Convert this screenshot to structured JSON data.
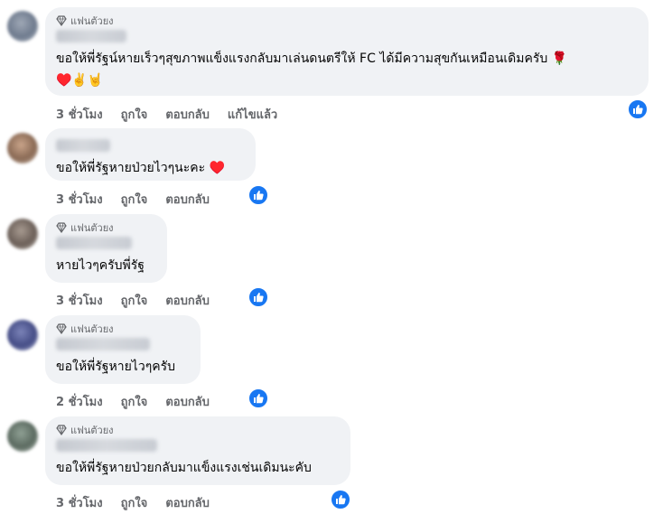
{
  "comments": [
    {
      "badge": "แฟนตัวยง",
      "text": "ขอให้พี่รัฐน์หายเร็วๆสุขภาพแข็งแรงกลับมาเล่นดนตรีให้ FC ได้มีความสุขกันเหมือนเดิมครับ 🌹",
      "text2": "♥️✌️🤘",
      "time": "3 ชั่วโมง",
      "like": "ถูกใจ",
      "reply": "ตอบกลับ",
      "edited": "แก้ไขแล้ว"
    },
    {
      "text": "ขอให้พี่รัฐหายป่วยไวๆนะคะ ♥️",
      "time": "3 ชั่วโมง",
      "like": "ถูกใจ",
      "reply": "ตอบกลับ"
    },
    {
      "badge": "แฟนตัวยง",
      "text": "หายไวๆครับพี่รัฐ",
      "time": "3 ชั่วโมง",
      "like": "ถูกใจ",
      "reply": "ตอบกลับ"
    },
    {
      "badge": "แฟนตัวยง",
      "text": "ขอให้พี่รัฐหายไวๆครับ",
      "time": "2 ชั่วโมง",
      "like": "ถูกใจ",
      "reply": "ตอบกลับ"
    },
    {
      "badge": "แฟนตัวยง",
      "text": "ขอให้พี่รัฐหายป่วยกลับมาแข็งแรงเช่นเดิมนะคับ",
      "time": "3 ชั่วโมง",
      "like": "ถูกใจ",
      "reply": "ตอบกลับ"
    }
  ],
  "colors": {
    "bubble": "#f0f2f5",
    "secondary_text": "#65676b",
    "like_blue": "#1877f2"
  },
  "icons": [
    "diamond-icon",
    "thumbs-up-reaction-icon"
  ]
}
